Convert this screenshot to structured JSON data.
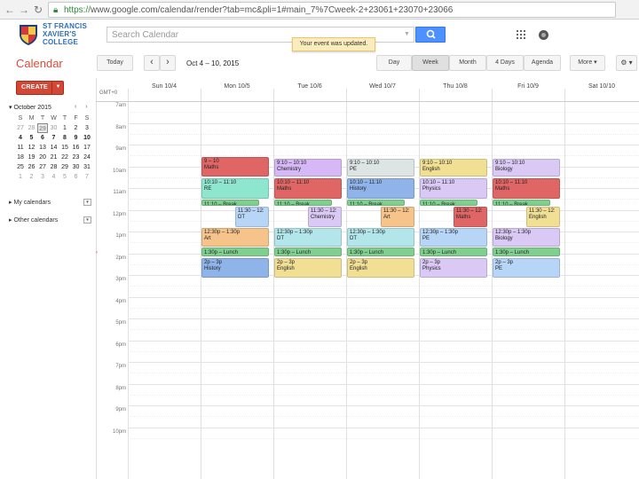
{
  "browser": {
    "url_https": "https://",
    "url_rest": "www.google.com/calendar/render?tab=mc&pli=1#main_7%7Cweek-2+23061+23070+23066"
  },
  "header": {
    "school_name": "ST FRANCIS\nXAVIER'S\nCOLLEGE",
    "search_placeholder": "Search Calendar",
    "toast": "Your event was updated."
  },
  "toolbar": {
    "title": "Calendar",
    "today": "Today",
    "prev": "‹",
    "next": "›",
    "date_range": "Oct 4 – 10, 2015",
    "views": [
      "Day",
      "Week",
      "Month",
      "4 Days",
      "Agenda"
    ],
    "more": "More ▾",
    "settings": "⚙ ▾"
  },
  "sidebar": {
    "create": "CREATE",
    "create_dd": "▼",
    "mini_title": "▾ October 2015",
    "mini_arrows": "‹ ›",
    "weekdays": [
      "S",
      "M",
      "T",
      "W",
      "T",
      "F",
      "S"
    ],
    "weeks": [
      [
        "27",
        "28",
        "29",
        "30",
        "1",
        "2",
        "3"
      ],
      [
        "4",
        "5",
        "6",
        "7",
        "8",
        "9",
        "10"
      ],
      [
        "11",
        "12",
        "13",
        "14",
        "15",
        "16",
        "17"
      ],
      [
        "18",
        "19",
        "20",
        "21",
        "22",
        "23",
        "24"
      ],
      [
        "25",
        "26",
        "27",
        "28",
        "29",
        "30",
        "31"
      ],
      [
        "1",
        "2",
        "3",
        "4",
        "5",
        "6",
        "7"
      ]
    ],
    "my_calendars": "▸ My calendars",
    "other_calendars": "▸ Other calendars",
    "dd": "▾"
  },
  "grid": {
    "gmt": "GMT+0",
    "days": [
      "Sun 10/4",
      "Mon 10/5",
      "Tue 10/6",
      "Wed 10/7",
      "Thu 10/8",
      "Fri 10/9",
      "Sat 10/10"
    ],
    "hours": [
      "7am",
      "8am",
      "9am",
      "10am",
      "11am",
      "12pm",
      "1pm",
      "2pm",
      "3pm",
      "4pm",
      "5pm",
      "6pm",
      "7pm",
      "8pm",
      "9pm",
      "10pm"
    ],
    "now_marker": "›"
  },
  "colors": {
    "red": "#e06666",
    "purple": "#d5b8f5",
    "grey": "#dde4e4",
    "yellow": "#f1e094",
    "teal": "#8fe6cf",
    "blue": "#8fb4ea",
    "green": "#7fd08f",
    "orange": "#f6c48b",
    "cyan": "#b3e6ea",
    "lightblue": "#b7d5f7",
    "lavender": "#d9c9f4"
  },
  "events": [
    {
      "day": 1,
      "start": 9.33,
      "end": 10.25,
      "color": "red",
      "time": "9 – 10",
      "title": "Maths"
    },
    {
      "day": 2,
      "start": 9.4,
      "end": 10.25,
      "color": "purple",
      "time": "9:10 – 10:10",
      "title": "Chemistry"
    },
    {
      "day": 3,
      "start": 9.4,
      "end": 10.25,
      "color": "grey",
      "time": "9:10 – 10:10",
      "title": "PE"
    },
    {
      "day": 4,
      "start": 9.4,
      "end": 10.25,
      "color": "yellow",
      "time": "9:10 – 10:10",
      "title": "English"
    },
    {
      "day": 5,
      "start": 9.4,
      "end": 10.25,
      "color": "lavender",
      "time": "9:10 – 10:10",
      "title": "Biology"
    },
    {
      "day": 1,
      "start": 10.3,
      "end": 11.3,
      "color": "teal",
      "time": "10:10 – 11:10",
      "title": "RE"
    },
    {
      "day": 2,
      "start": 10.3,
      "end": 11.3,
      "color": "red",
      "time": "10:10 – 11:10",
      "title": "Maths"
    },
    {
      "day": 3,
      "start": 10.3,
      "end": 11.3,
      "color": "blue",
      "time": "10:10 – 11:10",
      "title": "History"
    },
    {
      "day": 4,
      "start": 10.3,
      "end": 11.3,
      "color": "lavender",
      "time": "10:10 – 11:10",
      "title": "Physics"
    },
    {
      "day": 5,
      "start": 10.3,
      "end": 11.3,
      "color": "red",
      "time": "10:10 – 11:10",
      "title": "Maths"
    },
    {
      "day": 1,
      "start": 11.3,
      "end": 11.6,
      "color": "green",
      "one": "11:10 – Break",
      "w": 0.85
    },
    {
      "day": 2,
      "start": 11.3,
      "end": 11.6,
      "color": "green",
      "one": "11:10 – Break",
      "w": 0.85
    },
    {
      "day": 3,
      "start": 11.3,
      "end": 11.6,
      "color": "green",
      "one": "11:10 – Break",
      "w": 0.85
    },
    {
      "day": 4,
      "start": 11.3,
      "end": 11.6,
      "color": "green",
      "one": "11:10 – Break",
      "w": 0.85
    },
    {
      "day": 5,
      "start": 11.3,
      "end": 11.6,
      "color": "green",
      "one": "11:10 – Break",
      "w": 0.85
    },
    {
      "day": 1,
      "start": 11.6,
      "end": 12.6,
      "color": "lightblue",
      "time": "11:30 – 12:",
      "title": "DT",
      "x0": 0.5
    },
    {
      "day": 2,
      "start": 11.6,
      "end": 12.6,
      "color": "lavender",
      "time": "11:30 – 12:",
      "title": "Chemistry",
      "x0": 0.5
    },
    {
      "day": 3,
      "start": 11.6,
      "end": 12.6,
      "color": "orange",
      "time": "11:30 – 12:",
      "title": "Art",
      "x0": 0.5
    },
    {
      "day": 4,
      "start": 11.6,
      "end": 12.6,
      "color": "red",
      "time": "11:30 – 12:",
      "title": "Maths",
      "x0": 0.5
    },
    {
      "day": 5,
      "start": 11.6,
      "end": 12.6,
      "color": "yellow",
      "time": "11:30 – 12:",
      "title": "English",
      "x0": 0.5
    },
    {
      "day": 1,
      "start": 12.6,
      "end": 13.5,
      "color": "orange",
      "time": "12:30p – 1:30p",
      "title": "Art"
    },
    {
      "day": 2,
      "start": 12.6,
      "end": 13.5,
      "color": "cyan",
      "time": "12:30p – 1:30p",
      "title": "DT"
    },
    {
      "day": 3,
      "start": 12.6,
      "end": 13.5,
      "color": "cyan",
      "time": "12:30p – 1:30p",
      "title": "DT"
    },
    {
      "day": 4,
      "start": 12.6,
      "end": 13.5,
      "color": "lightblue",
      "time": "12:30p – 1:30p",
      "title": "PE"
    },
    {
      "day": 5,
      "start": 12.6,
      "end": 13.5,
      "color": "lavender",
      "time": "12:30p – 1:30p",
      "title": "Biology"
    },
    {
      "day": 1,
      "start": 13.5,
      "end": 13.95,
      "color": "green",
      "one": "1:30p – Lunch"
    },
    {
      "day": 2,
      "start": 13.5,
      "end": 13.95,
      "color": "green",
      "one": "1:30p – Lunch"
    },
    {
      "day": 3,
      "start": 13.5,
      "end": 13.95,
      "color": "green",
      "one": "1:30p – Lunch"
    },
    {
      "day": 4,
      "start": 13.5,
      "end": 13.95,
      "color": "green",
      "one": "1:30p – Lunch"
    },
    {
      "day": 5,
      "start": 13.5,
      "end": 13.95,
      "color": "green",
      "one": "1:30p – Lunch"
    },
    {
      "day": 1,
      "start": 13.97,
      "end": 14.9,
      "color": "blue",
      "time": "2p – 3p",
      "title": "History"
    },
    {
      "day": 2,
      "start": 13.97,
      "end": 14.9,
      "color": "yellow",
      "time": "2p – 3p",
      "title": "English"
    },
    {
      "day": 3,
      "start": 13.97,
      "end": 14.9,
      "color": "yellow",
      "time": "2p – 3p",
      "title": "English"
    },
    {
      "day": 4,
      "start": 13.97,
      "end": 14.9,
      "color": "lavender",
      "time": "2p – 3p",
      "title": "Physics"
    },
    {
      "day": 5,
      "start": 13.97,
      "end": 14.9,
      "color": "lightblue",
      "time": "2p – 3p",
      "title": "PE"
    }
  ]
}
